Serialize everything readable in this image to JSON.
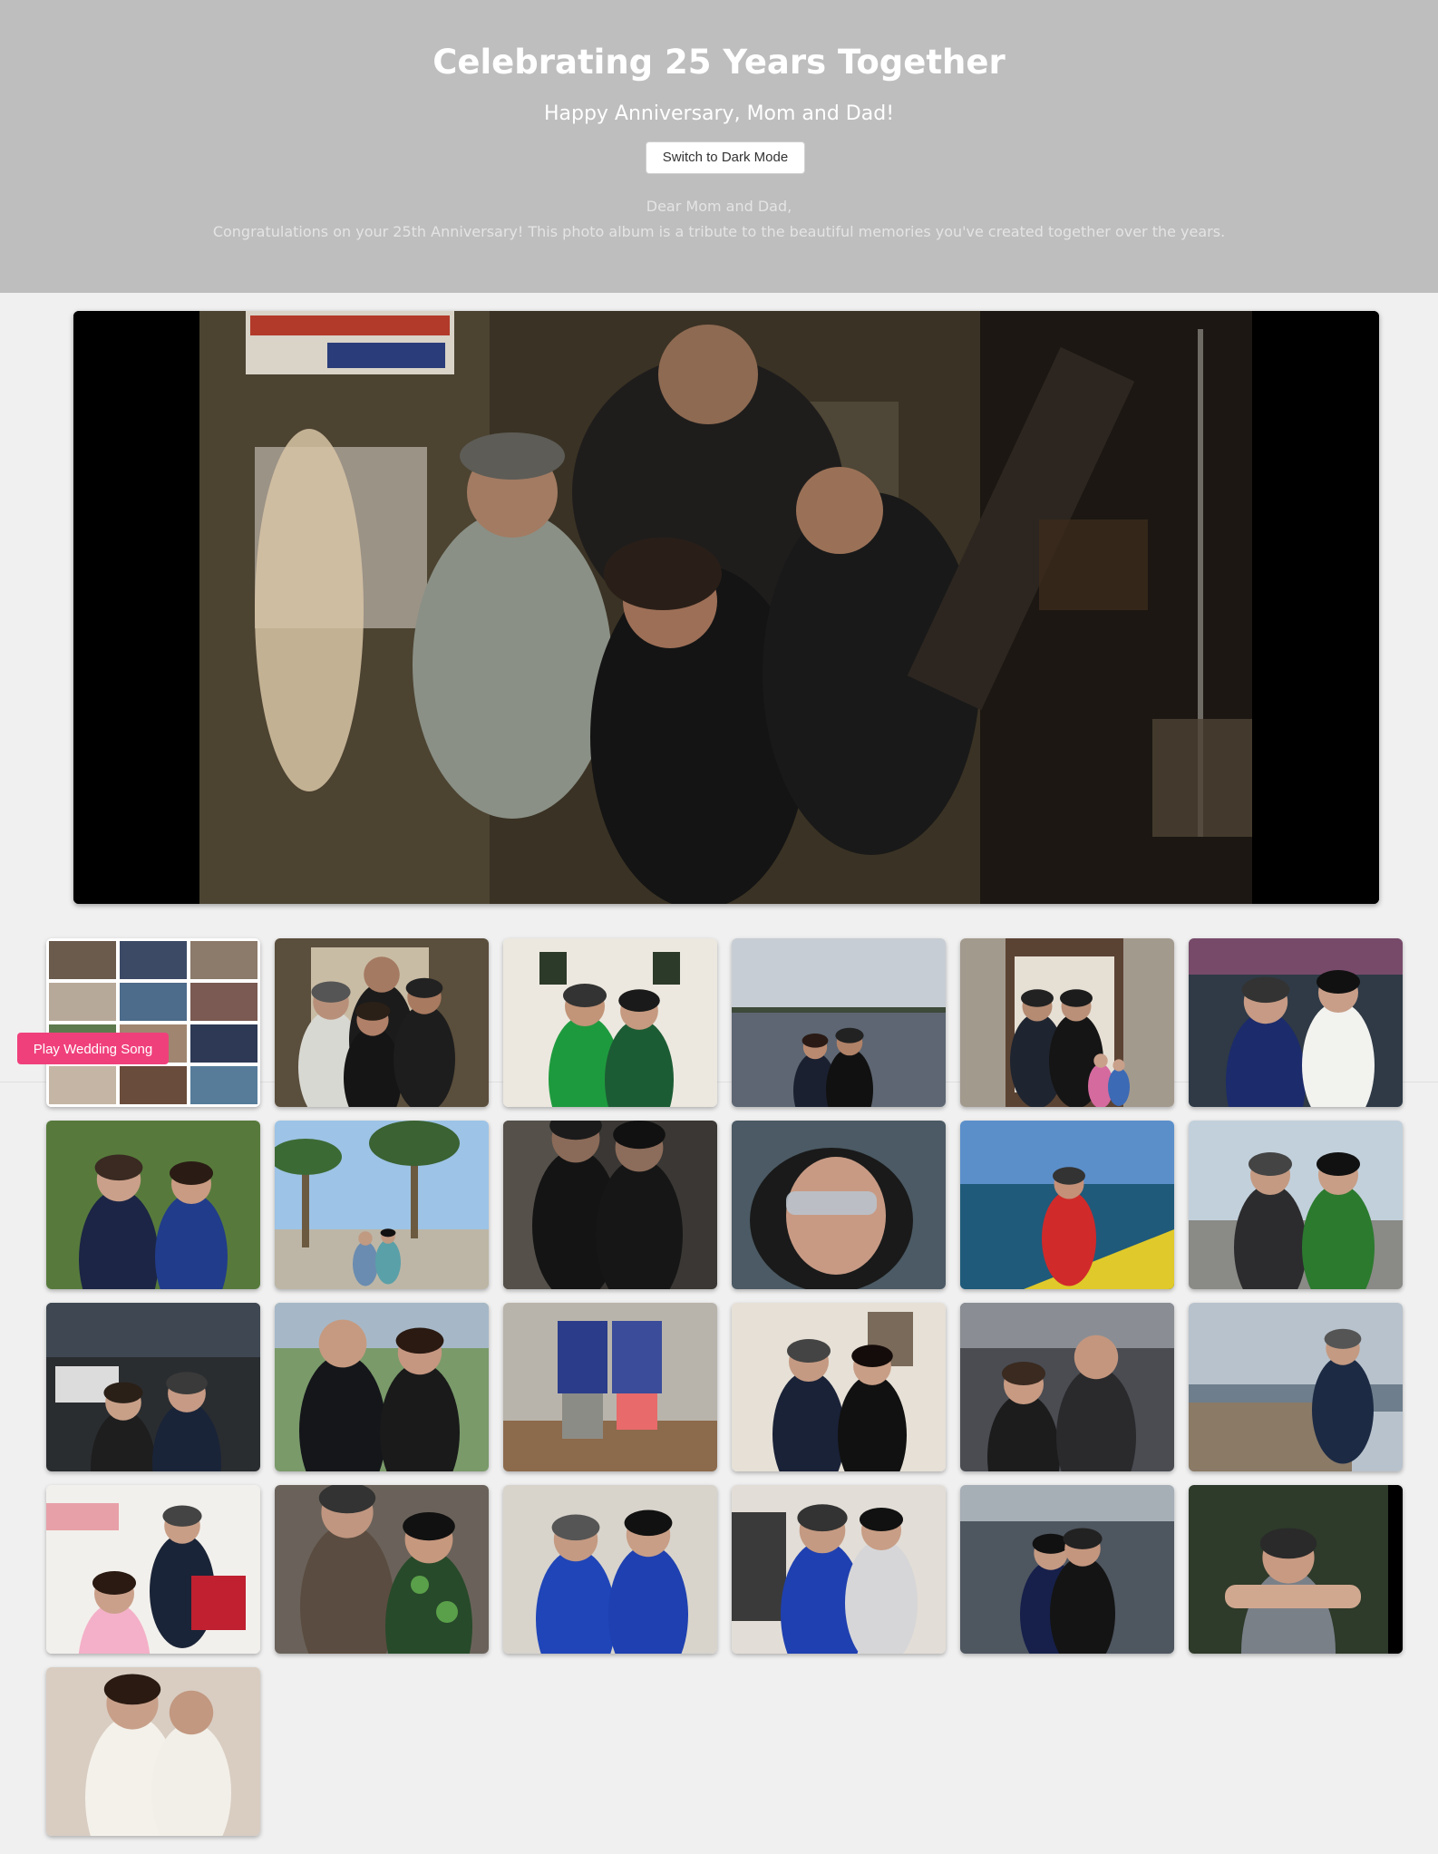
{
  "header": {
    "title": "Celebrating 25 Years Together",
    "subtitle": "Happy Anniversary, Mom and Dad!",
    "mode_button": "Switch to Dark Mode",
    "letter_greeting": "Dear Mom and Dad,",
    "letter_body": "Congratulations on your 25th Anniversary! This photo album is a tribute to the beautiful memories you've created together over the years."
  },
  "player": {
    "play_button": "Play Wedding Song",
    "accent_color": "#f0407b"
  },
  "colors": {
    "header_bg": "#bebebe",
    "page_bg": "#f0f0f0"
  },
  "hero_photo": {
    "scene": "group-bar"
  },
  "gallery": [
    {
      "scene": "collage"
    },
    {
      "scene": "group-bar"
    },
    {
      "scene": "pub-green"
    },
    {
      "scene": "lake"
    },
    {
      "scene": "barn-door"
    },
    {
      "scene": "kiss-party"
    },
    {
      "scene": "selfie-green"
    },
    {
      "scene": "palms"
    },
    {
      "scene": "dark-couple"
    },
    {
      "scene": "sunglasses"
    },
    {
      "scene": "boat"
    },
    {
      "scene": "fair"
    },
    {
      "scene": "restaurant"
    },
    {
      "scene": "tank-tops"
    },
    {
      "scene": "life-vests"
    },
    {
      "scene": "home-couple"
    },
    {
      "scene": "car-selfie"
    },
    {
      "scene": "pier"
    },
    {
      "scene": "market"
    },
    {
      "scene": "hawaiian"
    },
    {
      "scene": "bills"
    },
    {
      "scene": "bills-kiss"
    },
    {
      "scene": "river-kiss"
    },
    {
      "scene": "hug-back"
    },
    {
      "scene": "wedding"
    }
  ]
}
